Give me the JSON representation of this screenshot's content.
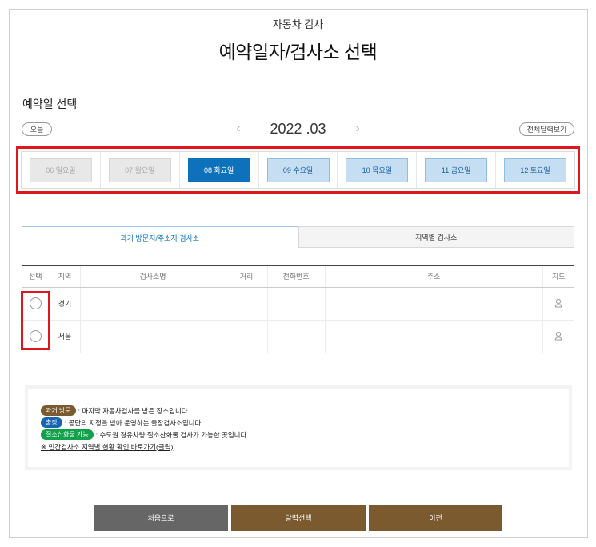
{
  "header": {
    "subtitle": "자동차 검사",
    "title": "예약일자/검사소 선택"
  },
  "date_section": {
    "title": "예약일 선택",
    "today_label": "오늘",
    "calendar_label": "전체달력보기",
    "month_label": "2022 .03",
    "prev_icon": "chevron-left-icon",
    "next_icon": "chevron-right-icon",
    "days": [
      {
        "label": "06  일요일",
        "state": "disabled"
      },
      {
        "label": "07  월요일",
        "state": "disabled"
      },
      {
        "label": "08  화요일",
        "state": "selected"
      },
      {
        "label": "09  수요일",
        "state": "available"
      },
      {
        "label": "10  목요일",
        "state": "available"
      },
      {
        "label": "11  금요일",
        "state": "available"
      },
      {
        "label": "12  토요일",
        "state": "available"
      }
    ]
  },
  "tabs": [
    {
      "label": "과거 방문지/주소지 검사소",
      "active": true
    },
    {
      "label": "지역별 검사소",
      "active": false
    }
  ],
  "table": {
    "headers": [
      "선택",
      "지역",
      "검사소명",
      "거리",
      "전화번호",
      "주소",
      "지도"
    ],
    "rows": [
      {
        "region": "경기",
        "name": "",
        "distance": "",
        "phone": "",
        "address": "",
        "map_icon": "map-pin-icon"
      },
      {
        "region": "서울",
        "name": "",
        "distance": "",
        "phone": "",
        "address": "",
        "map_icon": "map-pin-icon"
      }
    ]
  },
  "legend": {
    "items": [
      {
        "badge": "과거 방문",
        "color": "#7a5a2e",
        "text": ": 마지막 자동차검사를 받은 장소입니다."
      },
      {
        "badge": "출장",
        "color": "#1565b0",
        "text": ": 공단의 지정을 받아 운영하는 출장검사소입니다."
      },
      {
        "badge": "질소산화물 가능",
        "color": "#11a14a",
        "text": ": 수도권 경유차량 질소산화물 검사가 가능한 곳입니다."
      }
    ],
    "link_text": "※ 민간검사소 지역별 현황 확인 바로가기(클릭)"
  },
  "buttons": {
    "first": "처음으로",
    "calendar": "달력선택",
    "prev": "이전"
  },
  "colors": {
    "accent_blue": "#0d72bb",
    "brown": "#7a5a2e",
    "highlight_red": "#e0161c"
  }
}
